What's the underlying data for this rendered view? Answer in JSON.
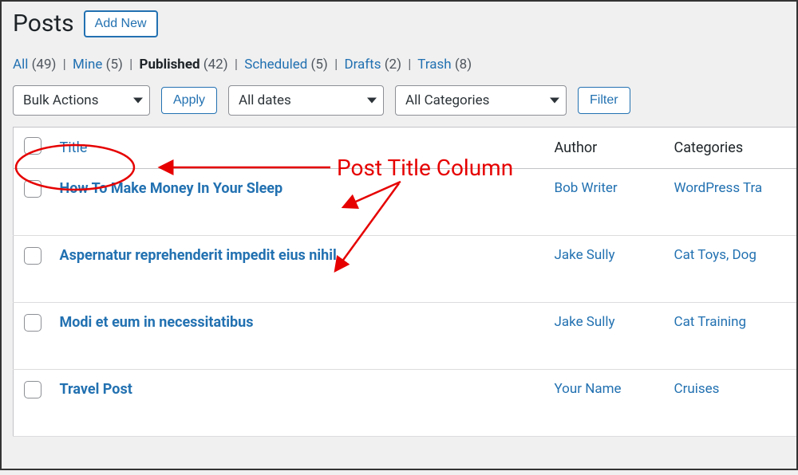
{
  "header": {
    "title": "Posts",
    "add_new": "Add New"
  },
  "filters": {
    "all_label": "All",
    "all_count": "(49)",
    "mine_label": "Mine",
    "mine_count": "(5)",
    "published_label": "Published",
    "published_count": "(42)",
    "scheduled_label": "Scheduled",
    "scheduled_count": "(5)",
    "drafts_label": "Drafts",
    "drafts_count": "(2)",
    "trash_label": "Trash",
    "trash_count": "(8)"
  },
  "controls": {
    "bulk": "Bulk Actions",
    "apply": "Apply",
    "dates": "All dates",
    "categories": "All Categories",
    "filter": "Filter"
  },
  "columns": {
    "title": "Title",
    "author": "Author",
    "categories": "Categories"
  },
  "rows": [
    {
      "title": "How To Make Money In Your Sleep",
      "author": "Bob Writer",
      "categories": "WordPress Tra"
    },
    {
      "title": "Aspernatur reprehenderit impedit eius nihil",
      "author": "Jake Sully",
      "categories": "Cat Toys, Dog "
    },
    {
      "title": "Modi et eum in necessitatibus",
      "author": "Jake Sully",
      "categories": "Cat Training"
    },
    {
      "title": "Travel Post",
      "author": "Your Name",
      "categories": "Cruises"
    }
  ],
  "annotation": {
    "label": "Post Title Column"
  }
}
